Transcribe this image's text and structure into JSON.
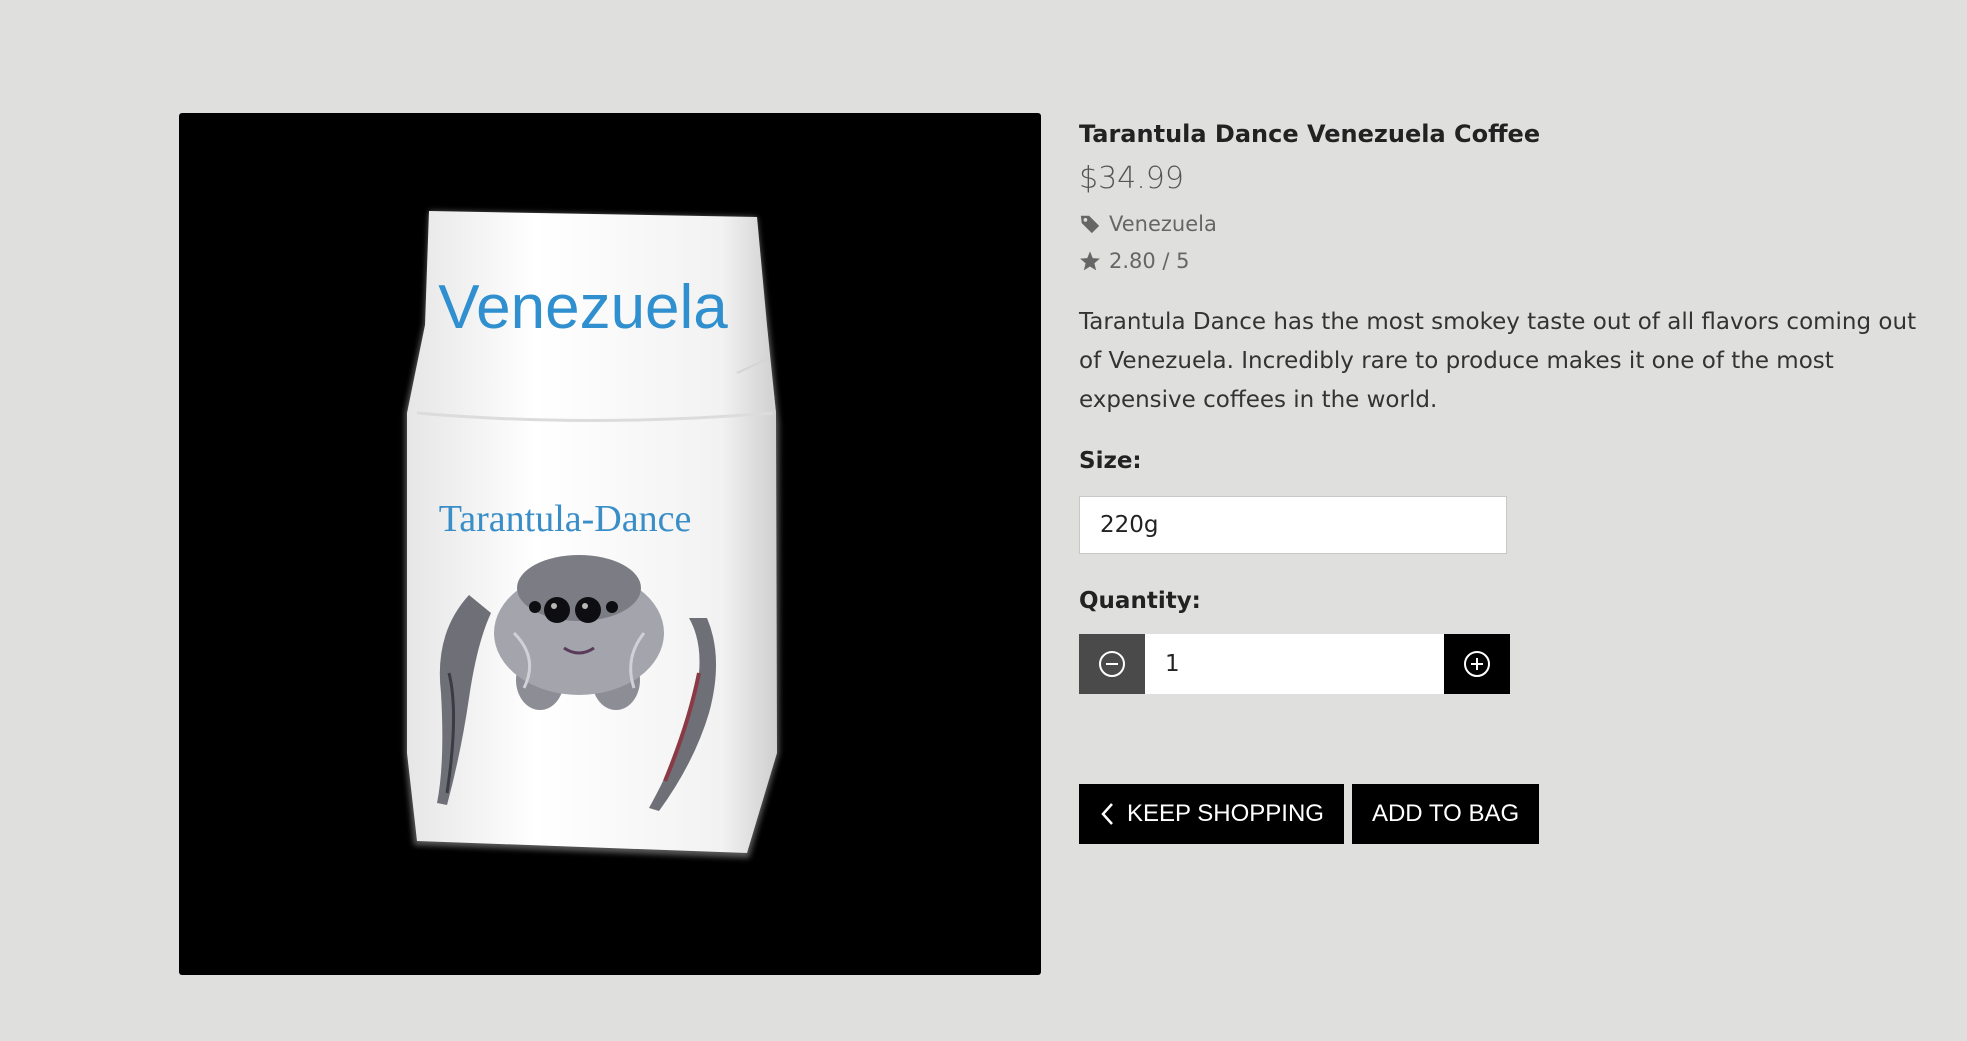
{
  "product": {
    "title": "Tarantula Dance Venezuela Coffee",
    "price": "$34.99",
    "category": "Venezuela",
    "rating": "2.80 / 5",
    "description": "Tarantula Dance has the most smokey taste out of all flavors coming out of Venezuela. Incredibly rare to produce makes it one of the most expensive coffees in the world.",
    "image": {
      "bag_text_top": "Venezuela",
      "bag_text_brand": "Tarantula-Dance",
      "icon": "coffee-bag-with-spider"
    }
  },
  "size": {
    "label": "Size:",
    "selected": "220g"
  },
  "quantity": {
    "label": "Quantity:",
    "value": "1",
    "decrease_icon": "minus-circle-icon",
    "increase_icon": "plus-circle-icon"
  },
  "actions": {
    "keep_shopping": "KEEP SHOPPING",
    "add_to_bag": "ADD TO BAG"
  },
  "colors": {
    "background": "#dfe0de",
    "button": "#000000",
    "minus_button": "#4a4a4a",
    "bag_text": "#2f8fcf"
  }
}
